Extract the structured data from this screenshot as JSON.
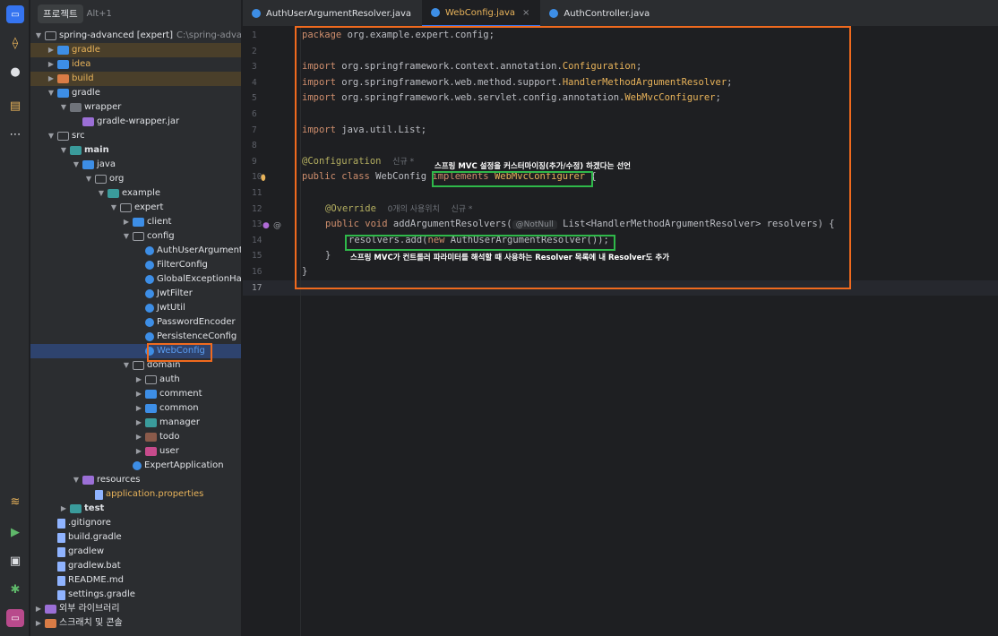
{
  "project_panel": {
    "title": "프로젝트",
    "shortcut": "Alt+1",
    "tree": [
      {
        "label": "spring-advanced [expert]",
        "extra": "C:\\spring-advanced",
        "depth": 0,
        "chev": "v",
        "icon": "folder outline"
      },
      {
        "label": "gradle",
        "depth": 1,
        "chev": ">",
        "icon": "blue",
        "color": "#e8b35a",
        "hl": true
      },
      {
        "label": "idea",
        "depth": 1,
        "chev": ">",
        "icon": "blue",
        "color": "#e8b35a"
      },
      {
        "label": "build",
        "depth": 1,
        "chev": ">",
        "icon": "orange",
        "color": "#e8b35a",
        "hl": true
      },
      {
        "label": "gradle",
        "depth": 1,
        "chev": "v",
        "icon": "blue"
      },
      {
        "label": "wrapper",
        "depth": 2,
        "chev": "v",
        "icon": "folder"
      },
      {
        "label": "gradle-wrapper.jar",
        "depth": 3,
        "chev": "",
        "icon": "purple"
      },
      {
        "label": "src",
        "depth": 1,
        "chev": "v",
        "icon": "folder outline"
      },
      {
        "label": "main",
        "depth": 2,
        "chev": "v",
        "icon": "teal",
        "bold": true
      },
      {
        "label": "java",
        "depth": 3,
        "chev": "v",
        "icon": "blue"
      },
      {
        "label": "org",
        "depth": 4,
        "chev": "v",
        "icon": "folder outline"
      },
      {
        "label": "example",
        "depth": 5,
        "chev": "v",
        "icon": "teal"
      },
      {
        "label": "expert",
        "depth": 6,
        "chev": "v",
        "icon": "folder outline"
      },
      {
        "label": "client",
        "depth": 7,
        "chev": ">",
        "icon": "blue"
      },
      {
        "label": "config",
        "depth": 7,
        "chev": "v",
        "icon": "folder outline"
      },
      {
        "label": "AuthUserArgumentR",
        "depth": 8,
        "chev": "",
        "icon": "cls"
      },
      {
        "label": "FilterConfig",
        "depth": 8,
        "chev": "",
        "icon": "cls"
      },
      {
        "label": "GlobalExceptionHan",
        "depth": 8,
        "chev": "",
        "icon": "cls"
      },
      {
        "label": "JwtFilter",
        "depth": 8,
        "chev": "",
        "icon": "cls"
      },
      {
        "label": "JwtUtil",
        "depth": 8,
        "chev": "",
        "icon": "cls"
      },
      {
        "label": "PasswordEncoder",
        "depth": 8,
        "chev": "",
        "icon": "cls"
      },
      {
        "label": "PersistenceConfig",
        "depth": 8,
        "chev": "",
        "icon": "cls"
      },
      {
        "label": "WebConfig",
        "depth": 8,
        "chev": "",
        "icon": "cls",
        "selected": true,
        "color": "#5a9cf0"
      },
      {
        "label": "domain",
        "depth": 7,
        "chev": "v",
        "icon": "folder outline"
      },
      {
        "label": "auth",
        "depth": 8,
        "chev": ">",
        "icon": "folder outline"
      },
      {
        "label": "comment",
        "depth": 8,
        "chev": ">",
        "icon": "blue"
      },
      {
        "label": "common",
        "depth": 8,
        "chev": ">",
        "icon": "blue"
      },
      {
        "label": "manager",
        "depth": 8,
        "chev": ">",
        "icon": "teal"
      },
      {
        "label": "todo",
        "depth": 8,
        "chev": ">",
        "icon": "brown"
      },
      {
        "label": "user",
        "depth": 8,
        "chev": ">",
        "icon": "pink"
      },
      {
        "label": "ExpertApplication",
        "depth": 7,
        "chev": "",
        "icon": "cls"
      },
      {
        "label": "resources",
        "depth": 3,
        "chev": "v",
        "icon": "purple"
      },
      {
        "label": "application.properties",
        "depth": 4,
        "chev": "",
        "icon": "file",
        "color": "#e8b35a"
      },
      {
        "label": "test",
        "depth": 2,
        "chev": ">",
        "icon": "teal",
        "bold": true
      },
      {
        "label": ".gitignore",
        "depth": 1,
        "chev": "",
        "icon": "file"
      },
      {
        "label": "build.gradle",
        "depth": 1,
        "chev": "",
        "icon": "file"
      },
      {
        "label": "gradlew",
        "depth": 1,
        "chev": "",
        "icon": "file"
      },
      {
        "label": "gradlew.bat",
        "depth": 1,
        "chev": "",
        "icon": "file"
      },
      {
        "label": "README.md",
        "depth": 1,
        "chev": "",
        "icon": "file"
      },
      {
        "label": "settings.gradle",
        "depth": 1,
        "chev": "",
        "icon": "file"
      },
      {
        "label": "외부 라이브러리",
        "depth": 0,
        "chev": ">",
        "icon": "purple"
      },
      {
        "label": "스크래치 및 콘솔",
        "depth": 0,
        "chev": ">",
        "icon": "orange"
      }
    ]
  },
  "tabs": [
    {
      "label": "AuthUserArgumentResolver.java",
      "active": false
    },
    {
      "label": "WebConfig.java",
      "active": true
    },
    {
      "label": "AuthController.java",
      "active": false
    }
  ],
  "editor": {
    "line_numbers": [
      "1",
      "2",
      "3",
      "4",
      "5",
      "6",
      "7",
      "8",
      "9",
      "10",
      "11",
      "12",
      "13",
      "14",
      "15",
      "16",
      "17"
    ],
    "lines": {
      "l1": [
        "package",
        " org.example.expert.config;"
      ],
      "l3": [
        "import",
        " org.springframework.context.annotation.",
        "Configuration",
        ";"
      ],
      "l4": [
        "import",
        " org.springframework.web.method.support.",
        "HandlerMethodArgumentResolver",
        ";"
      ],
      "l5": [
        "import",
        " org.springframework.web.servlet.config.annotation.",
        "WebMvcConfigurer",
        ";"
      ],
      "l7": [
        "import",
        " java.util.List;"
      ],
      "l9": [
        "@Configuration",
        "신규 *"
      ],
      "l10": [
        "public class",
        " WebConfig ",
        "implements",
        " WebMvcConfigurer",
        " {"
      ],
      "l12": [
        "@Override",
        "0개의 사용위치",
        "신규 *"
      ],
      "l13": [
        "public void",
        " addArgumentResolvers(",
        "@NotNull",
        " List<HandlerMethodArgumentResolver> resolvers) {"
      ],
      "l14": [
        "resolvers.add(",
        "new",
        " AuthUserArgumentResolver());"
      ],
      "l15": [
        "}"
      ],
      "l16": [
        "}"
      ]
    },
    "notes": {
      "note1": "스프링 MVC 설정을 커스터마이징(추가/수정) 하겠다는 선언",
      "note2": "스프링 MVC가 컨트롤러 파라미터를 해석할 때 사용하는 Resolver 목록에 내 Resolver도 추가"
    }
  },
  "colors": {
    "accent": "#3574f0",
    "annotation_orange": "#f06a1e",
    "annotation_green": "#2fb84a"
  }
}
